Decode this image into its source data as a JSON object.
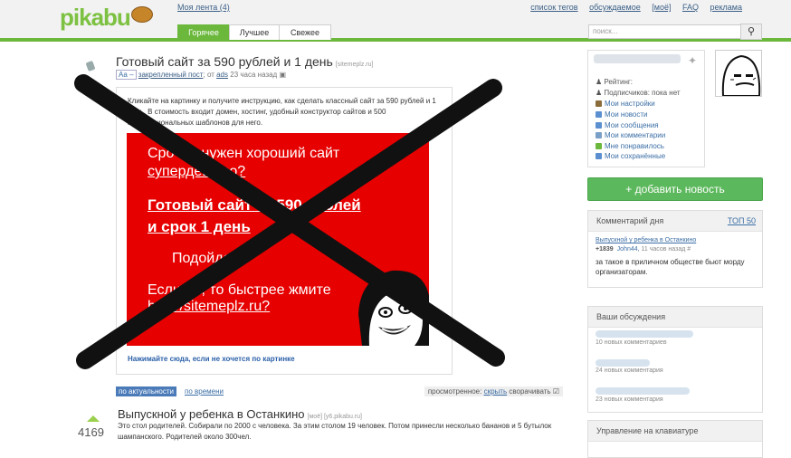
{
  "header": {
    "logo": "pikabu",
    "my_feed": "Моя лента (4)",
    "top_links": [
      "список тегов",
      "обсуждаемое",
      "[моё]",
      "FAQ",
      "реклама"
    ],
    "tabs": [
      "Горячее",
      "Лучшее",
      "Свежее"
    ],
    "search_placeholder": "поиск..."
  },
  "post": {
    "title": "Готовый сайт за 590 рублей и 1 день",
    "source": "[sitemeplz.ru]",
    "aa": "Аа –",
    "pinned": "закрепленный пост",
    "from": "от",
    "author": "ads",
    "time": "23 часа назад",
    "intro": "Кликайте на картинку и получите инструкцию, как сделать классный сайт за 590 рублей и 1 день. В стоимость входит домен, хостинг, удобный конструктор сайтов и 500 профессиональных шаблонов для него.",
    "banner": {
      "l1": "Срочно нужен хороший сайт",
      "l2": "супердешево?",
      "l3": "Готовый сайт за 590 рублей",
      "l4": "и срок 1 день",
      "l5": "Подойдет?",
      "l6": "Если да, то быстрее жмите",
      "l7": "http://sitemeplz.ru?"
    },
    "hide_link": "Нажимайте сюда, если не хочется по картинке"
  },
  "sort": {
    "relevance": "по актуальности",
    "by_time": "по времени",
    "viewed": "просмотренное:",
    "hide": "скрыть",
    "collapse": "сворачивать"
  },
  "post2": {
    "rating": "4169",
    "title": "Выпускной у ребенка в Останкино",
    "tags": "[моё] [y6.pikabu.ru]",
    "text": "Это стол родителей. Собирали по 2000 с человека. За этим столом 19 человек. Потом принесли несколько бананов и 5 бутылок шампанского. Родителей около 300чел."
  },
  "profile": {
    "rating_label": "Рейтинг:",
    "subscribers": "Подписчиков: пока нет",
    "links": [
      "Мои настройки",
      "Мои новости",
      "Мои сообщения",
      "Мои комментарии",
      "Мне понравилось",
      "Мои сохранённые"
    ],
    "icon_colors": [
      "#8a6d3b",
      "#5b8fcf",
      "#5b8fcf",
      "#7aa0c8",
      "#6bb83d",
      "#5b8fcf"
    ]
  },
  "add_news": "добавить новость",
  "comment_of_day": {
    "title": "Комментарий дня",
    "top": "ТОП 50",
    "post_link": "Выпускной у ребенка в Останкино",
    "score": "+1839",
    "author": "John44,",
    "time": "11 часов назад",
    "hash": "#",
    "text": "за такое в приличном обществе бьют морду организаторам."
  },
  "discussions": {
    "title": "Ваши обсуждения",
    "items": [
      "10 новых комментариев",
      "24 новых комментария",
      "23 новых комментария"
    ]
  },
  "keyboard": {
    "title": "Управление на клавиатуре"
  }
}
